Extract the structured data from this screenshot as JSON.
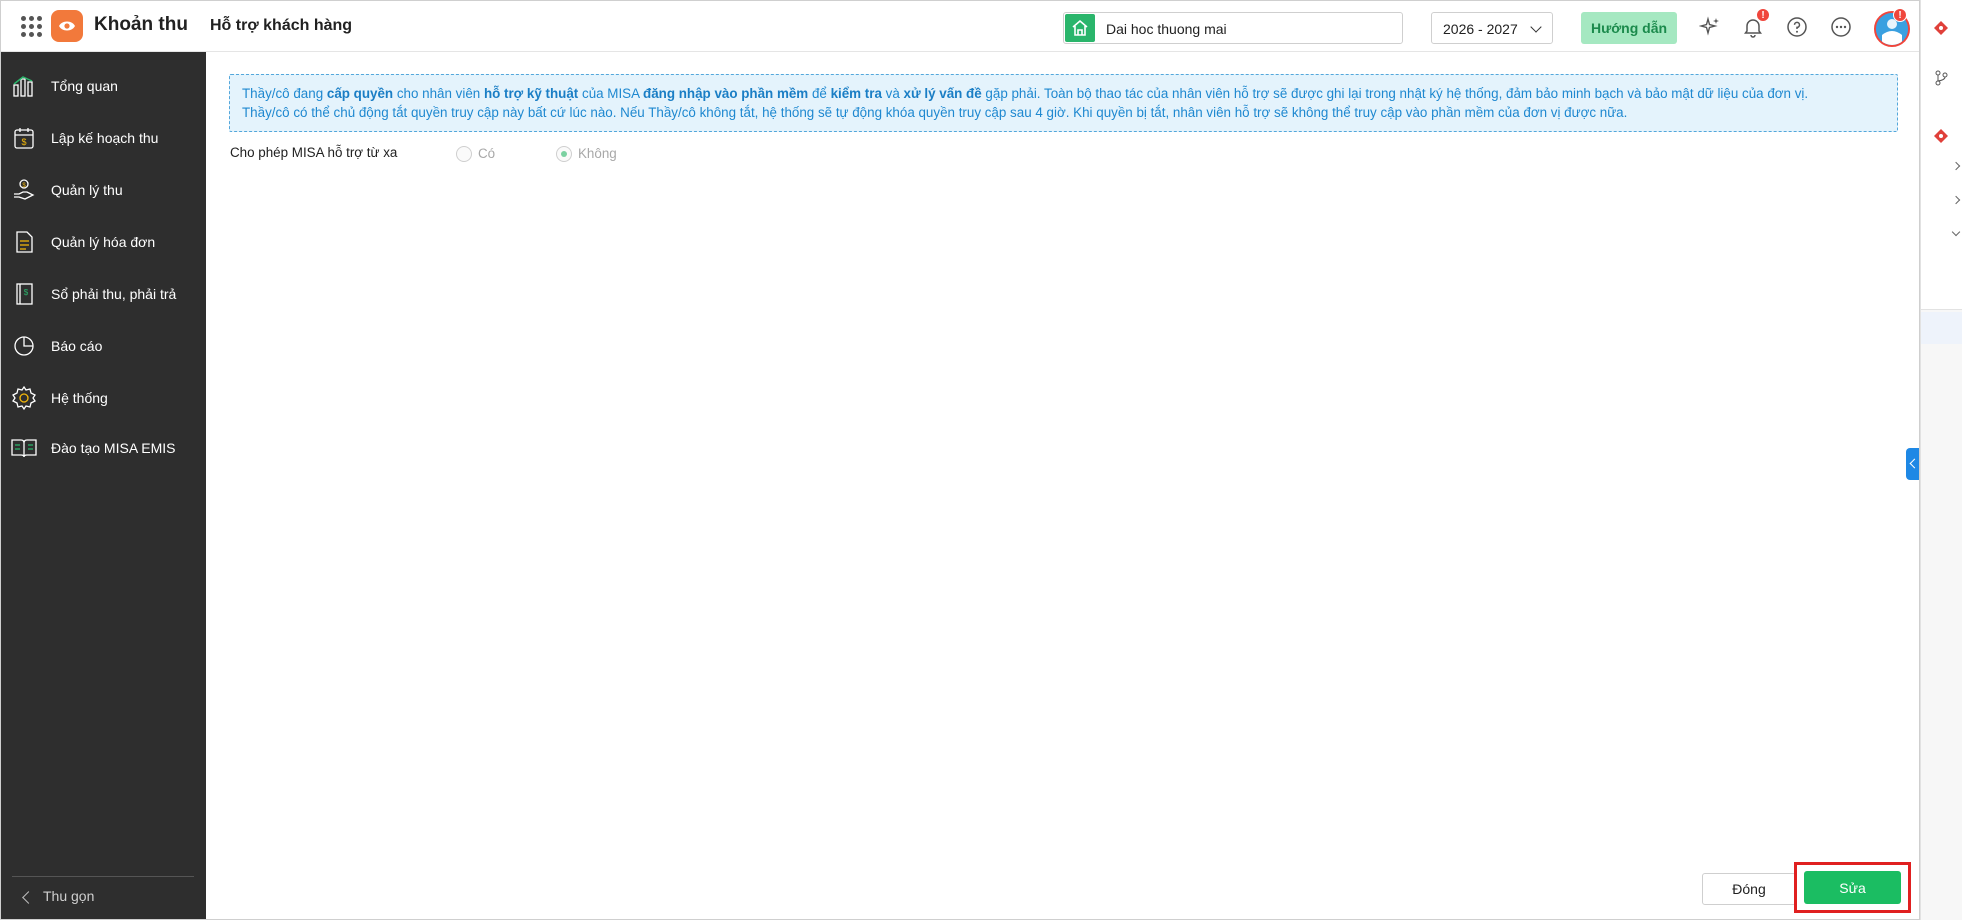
{
  "header": {
    "app_name": "Khoản thu",
    "page_title": "Hỗ trợ khách hàng",
    "org_name": "Dai hoc thuong mai",
    "school_year": "2026 - 2027",
    "guide_label": "Hướng dẫn",
    "notification_badge": "!",
    "avatar_badge": "!"
  },
  "sidebar": {
    "items": [
      {
        "label": "Tổng quan",
        "icon": "bar-chart-icon"
      },
      {
        "label": "Lập kế hoạch thu",
        "icon": "calendar-money-icon"
      },
      {
        "label": "Quản lý thu",
        "icon": "hand-coin-icon"
      },
      {
        "label": "Quản lý hóa đơn",
        "icon": "invoice-icon"
      },
      {
        "label": "Sổ phải thu, phải trả",
        "icon": "ledger-book-icon"
      },
      {
        "label": "Báo cáo",
        "icon": "pie-chart-icon"
      },
      {
        "label": "Hệ thống",
        "icon": "gear-icon"
      },
      {
        "label": "Đào tạo MISA EMIS",
        "icon": "open-book-icon"
      }
    ],
    "collapse_label": "Thu gọn"
  },
  "notice": {
    "line1": {
      "t1": "Thầy/cô đang ",
      "b1": "cấp quyền",
      "t2": " cho nhân viên ",
      "b2": "hỗ trợ kỹ thuật",
      "t3": " của MISA ",
      "b3": "đăng nhập vào phần mềm",
      "t4": " để ",
      "b4": "kiểm tra",
      "t5": " và ",
      "b5": "xử lý vấn đề",
      "t6": " gặp phải. Toàn bộ thao tác của nhân viên hỗ trợ sẽ được ghi lại trong nhật ký hệ thống, đảm bảo minh bạch và bảo mật dữ liệu của đơn vị."
    },
    "line2": "Thầy/cô có thể chủ động tắt quyền truy cập này bất cứ lúc nào. Nếu Thầy/cô không tắt, hệ thống sẽ tự động khóa quyền truy cập sau 4 giờ. Khi quyền bị tắt, nhân viên hỗ trợ sẽ không thể truy cập vào phần mềm của đơn vị được nữa."
  },
  "remote_support": {
    "label": "Cho phép MISA hỗ trợ từ xa",
    "options": [
      "Có",
      "Không"
    ],
    "selected": "Không"
  },
  "footer": {
    "close_label": "Đóng",
    "edit_label": "Sửa"
  },
  "colors": {
    "sidebar_bg": "#2e2e2e",
    "primary_green": "#1bbd62",
    "notice_blue": "#1e88d0",
    "brand_orange": "#f2793b",
    "highlight_red": "#e02020"
  }
}
